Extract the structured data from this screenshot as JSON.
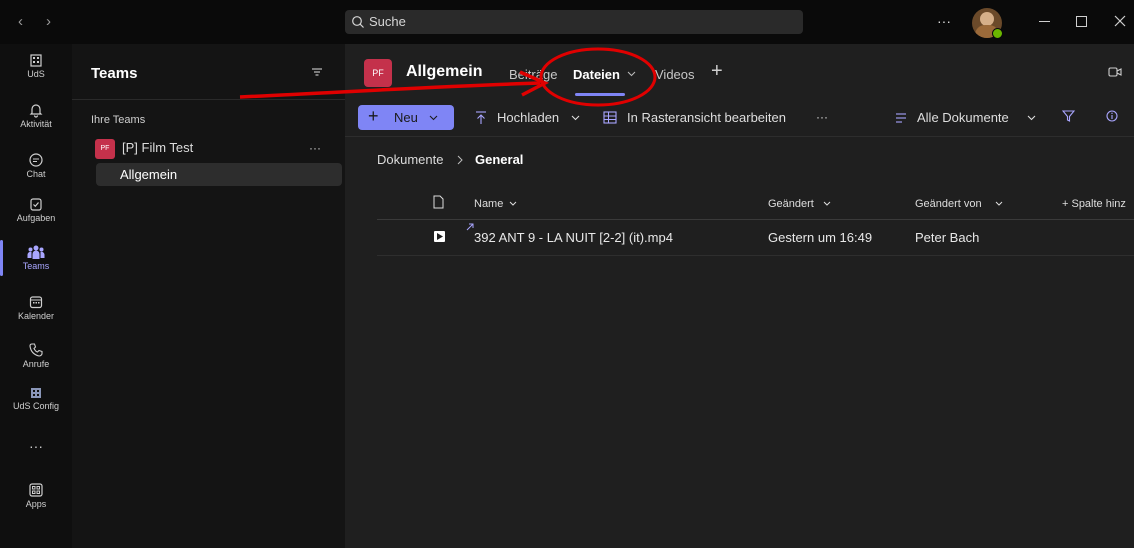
{
  "titlebar": {
    "search_placeholder": "Suche",
    "more": "···"
  },
  "rail": {
    "items": [
      {
        "label": "UdS"
      },
      {
        "label": "Aktivität"
      },
      {
        "label": "Chat"
      },
      {
        "label": "Aufgaben"
      },
      {
        "label": "Teams"
      },
      {
        "label": "Kalender"
      },
      {
        "label": "Anrufe"
      },
      {
        "label": "UdS Config"
      },
      {
        "label": "···"
      },
      {
        "label": "Apps"
      }
    ]
  },
  "teampane": {
    "title": "Teams",
    "section": "Ihre Teams",
    "team": {
      "initials": "PF",
      "name": "[P] Film Test",
      "more": "···"
    },
    "channel": "Allgemein"
  },
  "header": {
    "initials": "PF",
    "channel_name": "Allgemein",
    "tabs": [
      {
        "label": "Beiträge"
      },
      {
        "label": "Dateien"
      },
      {
        "label": "Videos"
      }
    ],
    "add_tab": "+"
  },
  "toolbar": {
    "new_label": "Neu",
    "upload_label": "Hochladen",
    "grid_label": "In Rasteransicht bearbeiten",
    "more": "···",
    "view_label": "Alle Dokumente"
  },
  "breadcrumb": {
    "root": "Dokumente",
    "current": "General"
  },
  "table": {
    "columns": {
      "name": "Name",
      "modified": "Geändert",
      "modified_by": "Geändert von",
      "add_column": "+ Spalte hinz"
    },
    "rows": [
      {
        "name": "392 ANT 9 - LA NUIT [2-2] (it).mp4",
        "modified": "Gestern um 16:49",
        "modified_by": "Peter Bach"
      }
    ]
  },
  "colors": {
    "accent": "#7f85f5",
    "annotation": "#e00000",
    "team_badge": "#c4314b"
  }
}
